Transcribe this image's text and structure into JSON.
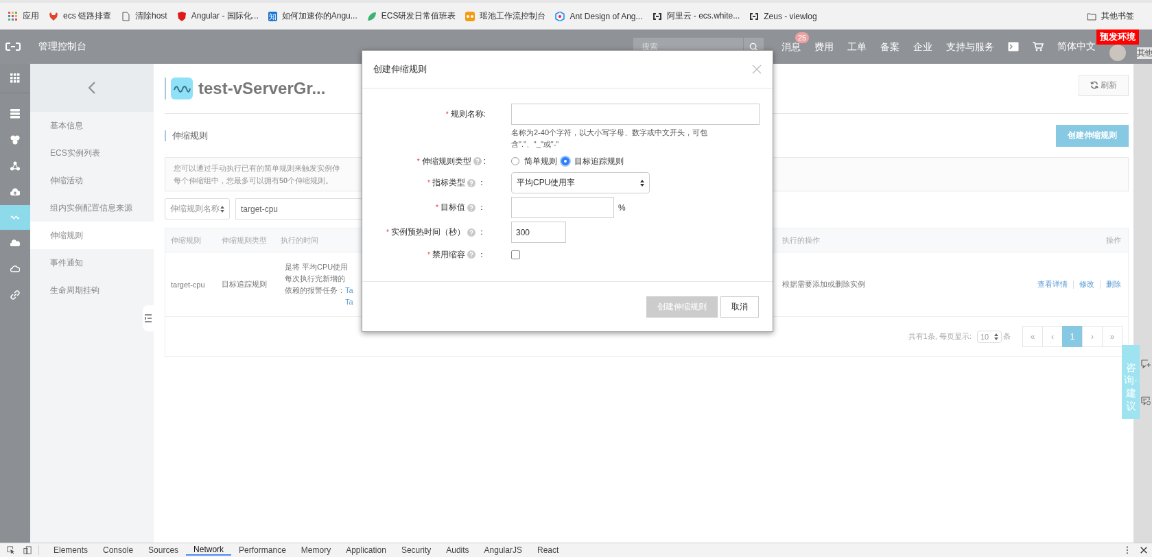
{
  "bookmarks": [
    {
      "label": "应用"
    },
    {
      "label": "ecs 链路排查"
    },
    {
      "label": "清除host"
    },
    {
      "label": "Angular - 国际化..."
    },
    {
      "label": "如何加速你的Angu...",
      "glyph": "知"
    },
    {
      "label": "ECS研发日常值班表"
    },
    {
      "label": "瑶池工作流控制台"
    },
    {
      "label": "Ant Design of Ang..."
    },
    {
      "label": "阿里云 - ecs.white..."
    },
    {
      "label": "Zeus - viewlog"
    }
  ],
  "other_bookmarks": "其他书签",
  "topbar": {
    "title": "管理控制台",
    "search": {
      "placeholder": "搜索"
    },
    "links": [
      {
        "label": "消息",
        "badge": "25"
      },
      {
        "label": "费用"
      },
      {
        "label": "工单"
      },
      {
        "label": "备案"
      },
      {
        "label": "企业"
      },
      {
        "label": "支持与服务"
      }
    ],
    "language": "简体中文",
    "env_tag": "预发环境",
    "cut_text": "其他"
  },
  "rail": [
    {
      "selected": false
    },
    {
      "selected": false
    },
    {
      "selected": false
    },
    {
      "selected": false
    },
    {
      "selected": false
    },
    {
      "selected": true
    },
    {
      "selected": false
    },
    {
      "selected": false
    },
    {
      "selected": false
    }
  ],
  "sidebar": {
    "items": [
      {
        "label": "基本信息",
        "selected": false
      },
      {
        "label": "ECS实例列表",
        "selected": false
      },
      {
        "label": "伸缩活动",
        "selected": false
      },
      {
        "label": "组内实例配置信息来源",
        "selected": false
      },
      {
        "label": "伸缩规则",
        "selected": true
      },
      {
        "label": "事件通知",
        "selected": false
      },
      {
        "label": "生命周期挂钩",
        "selected": false
      }
    ]
  },
  "page": {
    "title": "test-vServerGr...",
    "refresh": "刷新",
    "section": "伸缩规则",
    "create": "创建伸缩规则",
    "notice": [
      "您可以通过手动执行已有的简单规则来触发实例伸",
      "每个伸缩组中，您最多可以拥有**50**个伸缩规则。"
    ],
    "filter": {
      "select": "伸缩规则名称",
      "value": "target-cpu"
    },
    "table": {
      "columns": [
        "伸缩规则",
        "伸缩规则类型",
        "执行的时间",
        "执行的操作",
        "操作"
      ],
      "rows": [
        {
          "name": "target-cpu",
          "type": "目标追踪规则",
          "time": [
            "是将 平均CPU使用",
            "每次执行完新增的"
          ],
          "alarm_label": "依赖的报警任务：",
          "alarm_links": [
            "Ta",
            "Ta"
          ],
          "action": "根据需要添加或删除实例",
          "ops": [
            "查看详情",
            "修改",
            "删除"
          ]
        }
      ]
    },
    "pagination": {
      "summary": "共有1条, 每页显示:",
      "page_size": "10",
      "unit": "条",
      "pages": [
        {
          "label": "«",
          "selected": false
        },
        {
          "label": "‹",
          "selected": false
        },
        {
          "label": "1",
          "selected": true
        },
        {
          "label": "›",
          "selected": false
        },
        {
          "label": "»",
          "selected": false
        }
      ]
    }
  },
  "modal": {
    "title": "创建伸缩规则",
    "fields": [
      {
        "kind": "wide-input",
        "mark": "*",
        "label": "规则名称:",
        "help": false,
        "hint": "名称为2-40个字符，以大小写字母、数字或中文开头，可包含\".\"、\"_\"或\"-\""
      },
      {
        "kind": "radio",
        "mark": "*",
        "label": "伸缩规则类型",
        "help": true,
        "colon": ":",
        "options": [
          {
            "label": "简单规则",
            "selected": false
          },
          {
            "label": "目标追踪规则",
            "selected": true
          }
        ]
      },
      {
        "kind": "select",
        "mark": "*",
        "label": "指标类型",
        "help": true,
        "colon": "：",
        "value": "平均CPU使用率"
      },
      {
        "kind": "unit-input",
        "mark": "*",
        "label": "目标值",
        "help": true,
        "colon": "：",
        "unit": "%"
      },
      {
        "kind": "short-input",
        "mark": "*",
        "label": "实例预热时间（秒）",
        "help": true,
        "colon": "：",
        "value": "300"
      },
      {
        "kind": "checkbox",
        "mark": "*",
        "label": "禁用缩容",
        "help": true,
        "colon": "：",
        "checked": false
      }
    ],
    "buttons": [
      {
        "label": "创建伸缩规则",
        "disabled": true
      },
      {
        "label": "取消",
        "disabled": false
      }
    ]
  },
  "feedback_tab": "咨询·建议",
  "devtools": {
    "tabs": [
      {
        "label": "Elements",
        "selected": false
      },
      {
        "label": "Console",
        "selected": false
      },
      {
        "label": "Sources",
        "selected": false
      },
      {
        "label": "Network",
        "selected": true
      },
      {
        "label": "Performance",
        "selected": false
      },
      {
        "label": "Memory",
        "selected": false
      },
      {
        "label": "Application",
        "selected": false
      },
      {
        "label": "Security",
        "selected": false
      },
      {
        "label": "Audits",
        "selected": false
      },
      {
        "label": "AngularJS",
        "selected": false
      },
      {
        "label": "React",
        "selected": false
      }
    ]
  }
}
